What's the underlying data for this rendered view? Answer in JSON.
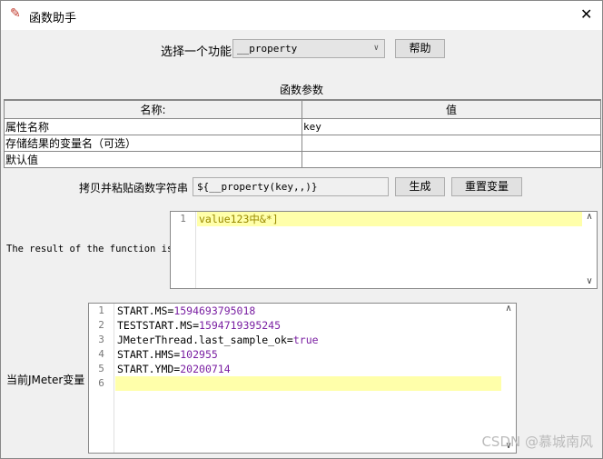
{
  "window": {
    "title": "函数助手",
    "icon": "feather-icon",
    "close_icon": "close-icon"
  },
  "function_select": {
    "label": "选择一个功能",
    "value": "__property",
    "help_label": "帮助"
  },
  "params": {
    "title": "函数参数",
    "columns": [
      "名称:",
      "值"
    ],
    "rows": [
      {
        "name": "属性名称",
        "value": "key"
      },
      {
        "name": "存储结果的变量名（可选）",
        "value": ""
      },
      {
        "name": "默认值",
        "value": ""
      }
    ]
  },
  "copy": {
    "label": "拷贝并粘贴函数字符串",
    "value": "${__property(key,,)}",
    "generate_label": "生成",
    "reset_label": "重置变量"
  },
  "result": {
    "label": "The result of the function is",
    "lines": [
      "value123中&*]"
    ]
  },
  "variables": {
    "label": "当前JMeter变量",
    "lines": [
      {
        "key": "START.MS=",
        "value": "1594693795018"
      },
      {
        "key": "TESTSTART.MS=",
        "value": "1594719395245"
      },
      {
        "key": "JMeterThread.last_sample_ok=",
        "value": "true"
      },
      {
        "key": "START.HMS=",
        "value": "102955"
      },
      {
        "key": "START.YMD=",
        "value": "20200714"
      },
      {
        "key": "",
        "value": ""
      }
    ]
  },
  "watermark": "CSDN @慕城南风",
  "colors": {
    "highlight": "#ffffaa",
    "value": "#7a1fa2",
    "result_text": "#9a8a00"
  }
}
